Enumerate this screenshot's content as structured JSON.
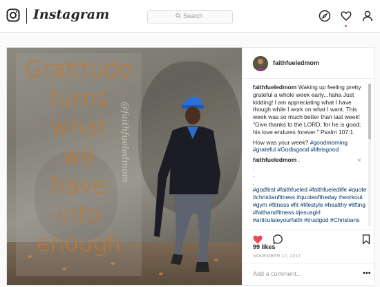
{
  "header": {
    "brand": "Instagram",
    "search_placeholder": "Search",
    "icons": [
      "camera-logo-icon",
      "compass-icon",
      "heart-icon",
      "profile-icon"
    ]
  },
  "post": {
    "photo": {
      "quote_lines": [
        "Gratitude",
        "turns",
        "what",
        "we",
        "have",
        "into",
        "enough"
      ],
      "watermark": "@faithfueledmom"
    },
    "author": "faithfueledmom",
    "caption": {
      "user": "faithfueledmom",
      "text": "Waking up feeling pretty grateful a whole week early...haha Just kidding! I am appreciating what I have though while I work on what I want. This week was so much better than last week! \"Give thanks to the LORD, for he is good; his love endures forever.\" Psalm 107:1",
      "question": "How was your week?",
      "tags": "#goodmorning #grateful #Godisgood #lifeisgood"
    },
    "comment": {
      "user": "faithfueledmom",
      "suffix": ".",
      "dots": [
        ".",
        ".",
        "."
      ],
      "hashtags": "#godfirst #faithfueled #faithfueledlife #quote #christianfitness #quoteoftheday #workout #gym #fitness #fit #lifestyle #healthy #lifting #faithandfitness #jesusgirl #articulateyourfaith #trustgod #Christians"
    },
    "close_symbol": "×",
    "likes": "99 likes",
    "date": "NOVEMBER 17, 2017",
    "add_comment_placeholder": "Add a comment...",
    "more_symbol": "•••",
    "accent_like": "#ed4956"
  }
}
